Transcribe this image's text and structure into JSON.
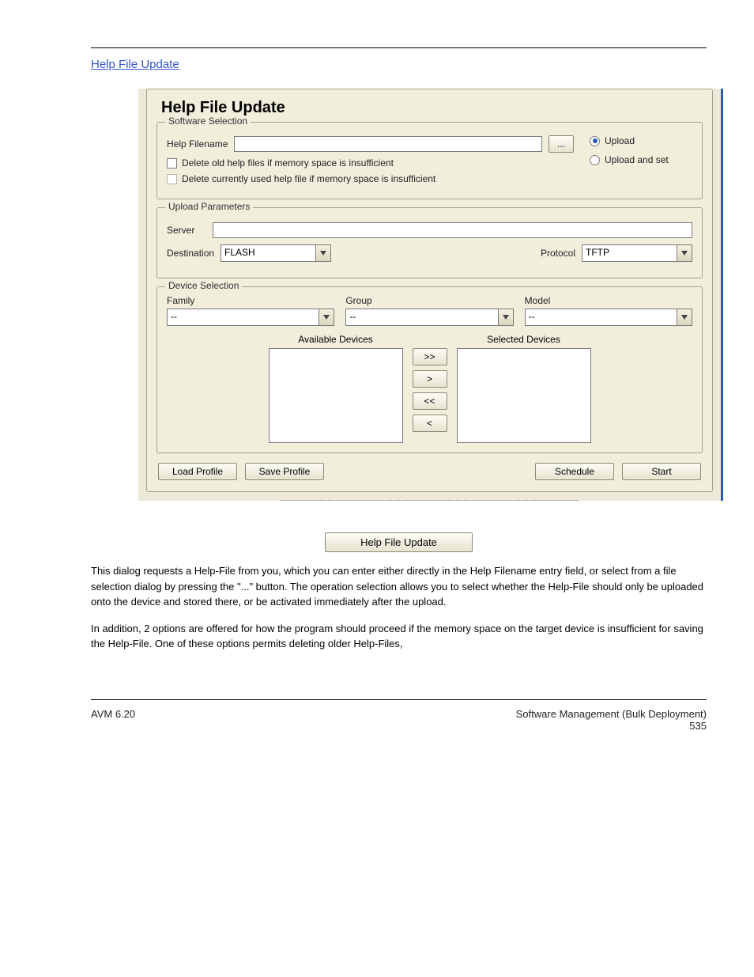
{
  "doc": {
    "section_link": "Help File Update",
    "panel_title": "Help File Update",
    "software_selection": {
      "legend": "Software Selection",
      "filename_label": "Help Filename",
      "filename_value": "",
      "browse_label": "...",
      "upload_label": "Upload",
      "upload_set_label": "Upload and set",
      "delete_old_label": "Delete old help files if memory space is insufficient",
      "delete_current_label": "Delete currently used help file if memory space is insufficient"
    },
    "upload_params": {
      "legend": "Upload Parameters",
      "server_label": "Server",
      "server_value": "",
      "destination_label": "Destination",
      "destination_value": "FLASH",
      "protocol_label": "Protocol",
      "protocol_value": "TFTP"
    },
    "device_selection": {
      "legend": "Device Selection",
      "family_label": "Family",
      "family_value": "--",
      "group_label": "Group",
      "group_value": "--",
      "model_label": "Model",
      "model_value": "--",
      "available_label": "Available Devices",
      "selected_label": "Selected Devices",
      "btn_add_all": ">>",
      "btn_add": ">",
      "btn_remove_all": "<<",
      "btn_remove": "<"
    },
    "buttons": {
      "load_profile": "Load Profile",
      "save_profile": "Save Profile",
      "schedule": "Schedule",
      "start": "Start"
    },
    "figure_button": "Help File Update",
    "paragraph1": "This dialog requests a Help-File from you, which you can enter either directly in the Help Filename entry field, or select from a file selection dialog by pressing the \"...\" button. The operation selection allows you to select whether the Help-File should only be uploaded onto the device and stored there, or be activated immediately after the upload.",
    "paragraph2": "In addition, 2 options are offered for how the program should proceed if the memory space on the target device is insufficient for saving the Help-File. One of these options permits deleting older Help-Files,",
    "footer_left": "AVM 6.20",
    "footer_right_line1": "Software Management (Bulk Deployment)",
    "footer_right_line2": "535"
  }
}
